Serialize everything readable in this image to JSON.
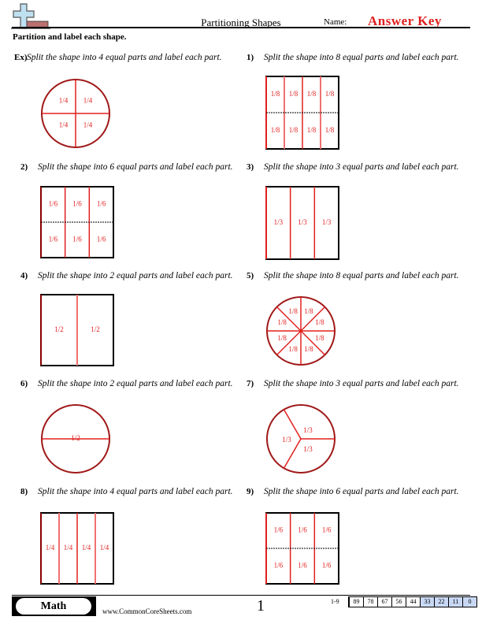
{
  "header": {
    "title": "Partitioning Shapes",
    "name_label": "Name:",
    "answer_key": "Answer Key",
    "logo": "plus-cross-logo-icon"
  },
  "instructions": "Partition and label each shape.",
  "problems": [
    {
      "num": "Ex)",
      "text": "Split the shape into 4 equal parts and label each part.",
      "shape": "circle",
      "parts": 4,
      "labels": [
        "1/4",
        "1/4",
        "1/4",
        "1/4"
      ]
    },
    {
      "num": "1)",
      "text": "Split the shape into 8 equal parts and label each part.",
      "shape": "rectangle",
      "parts": 8,
      "labels": [
        "1/8",
        "1/8",
        "1/8",
        "1/8",
        "1/8",
        "1/8",
        "1/8",
        "1/8"
      ]
    },
    {
      "num": "2)",
      "text": "Split the shape into 6 equal parts and label each part.",
      "shape": "rectangle",
      "parts": 6,
      "labels": [
        "1/6",
        "1/6",
        "1/6",
        "1/6",
        "1/6",
        "1/6"
      ]
    },
    {
      "num": "3)",
      "text": "Split the shape into 3 equal parts and label each part.",
      "shape": "rectangle",
      "parts": 3,
      "labels": [
        "1/3",
        "1/3",
        "1/3"
      ]
    },
    {
      "num": "4)",
      "text": "Split the shape into 2 equal parts and label each part.",
      "shape": "rectangle",
      "parts": 2,
      "labels": [
        "1/2",
        "1/2"
      ]
    },
    {
      "num": "5)",
      "text": "Split the shape into 8 equal parts and label each part.",
      "shape": "circle",
      "parts": 8,
      "labels": [
        "1/8",
        "1/8",
        "1/8",
        "1/8",
        "1/8",
        "1/8",
        "1/8",
        "1/8"
      ]
    },
    {
      "num": "6)",
      "text": "Split the shape into 2 equal parts and label each part.",
      "shape": "circle",
      "parts": 2,
      "labels": [
        "1/2"
      ]
    },
    {
      "num": "7)",
      "text": "Split the shape into 3 equal parts and label each part.",
      "shape": "circle",
      "parts": 3,
      "labels": [
        "1/3",
        "1/3",
        "1/3"
      ]
    },
    {
      "num": "8)",
      "text": "Split the shape into 4 equal parts and label each part.",
      "shape": "rectangle",
      "parts": 4,
      "labels": [
        "1/4",
        "1/4",
        "1/4",
        "1/4"
      ]
    },
    {
      "num": "9)",
      "text": "Split the shape into 6 equal parts and label each part.",
      "shape": "rectangle",
      "parts": 6,
      "labels": [
        "1/6",
        "1/6",
        "1/6",
        "1/6",
        "1/6",
        "1/6"
      ]
    }
  ],
  "colors": {
    "answer": "#e0201f",
    "circle_outline": "#a01818",
    "score_shaded": "#c8d8f4",
    "logo_blue": "#bfe0f0",
    "logo_red": "#b87070"
  },
  "footer": {
    "subject": "Math",
    "site": "www.CommonCoreSheets.com",
    "page": "1",
    "range": "1-9",
    "scores": [
      "89",
      "78",
      "67",
      "56",
      "44",
      "33",
      "22",
      "11",
      "0"
    ],
    "shaded_from_index": 5
  }
}
